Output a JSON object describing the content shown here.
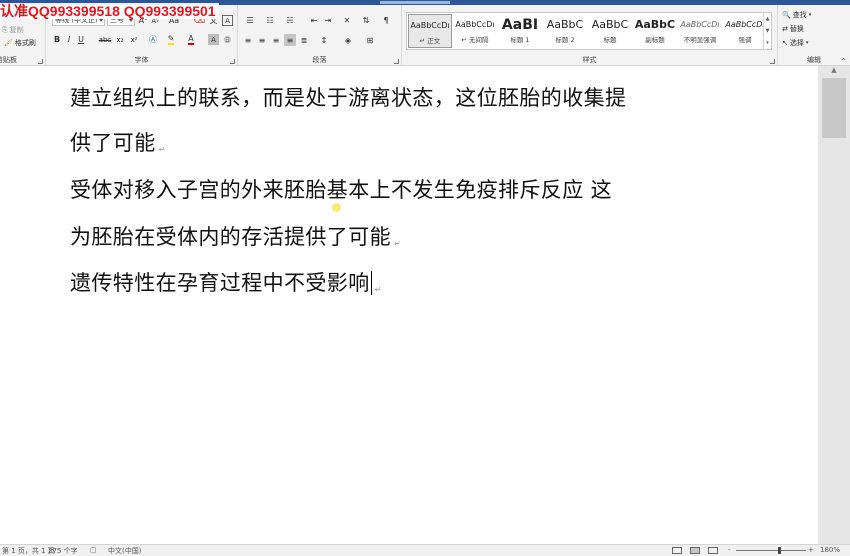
{
  "watermark": "认准QQ993399518  QQ993399501",
  "ribbon": {
    "clipboard": {
      "label": "剪贴板",
      "copy": "复制",
      "format_painter": "格式刷"
    },
    "font": {
      "label": "字体",
      "font_name": "等线 (中文正)",
      "font_size": "三号",
      "grow": "A",
      "shrink": "A",
      "case": "Aa",
      "bold": "B",
      "italic": "I",
      "underline": "U",
      "strike": "abc",
      "subscript": "x₂",
      "superscript": "x²",
      "font_color": "A",
      "char_shade": "A"
    },
    "paragraph": {
      "label": "段落"
    },
    "styles": {
      "label": "样式",
      "items": [
        {
          "sample": "AaBbCcDı",
          "name": "正文",
          "selected": true
        },
        {
          "sample": "AaBbCcDı",
          "name": "无间隔"
        },
        {
          "sample": "AaBI",
          "name": "标题 1"
        },
        {
          "sample": "AaBbC",
          "name": "标题 2"
        },
        {
          "sample": "AaBbC",
          "name": "标题"
        },
        {
          "sample": "AaBbC",
          "name": "副标题"
        },
        {
          "sample": "AaBbCcDı",
          "name": "不明显强调"
        },
        {
          "sample": "AaBbCcDı",
          "name": "强调"
        }
      ]
    },
    "editing": {
      "label": "编辑",
      "find": "查找",
      "replace": "替换",
      "select": "选择"
    }
  },
  "document": {
    "lines": [
      "建立组织上的联系，而是处于游离状态，这位胚胎的收集提",
      "供了可能",
      "受体对移入子宫的外来胚胎基本上不发生免疫排斥反应  这",
      "为胚胎在受体内的存活提供了可能",
      "遗传特性在孕育过程中不受影响"
    ],
    "para_mark": "↵"
  },
  "statusbar": {
    "page": "第 1 页，共 1 页",
    "words": "275 个字",
    "language": "中文(中国)",
    "zoom": "180%",
    "minus": "-",
    "plus": "+"
  }
}
